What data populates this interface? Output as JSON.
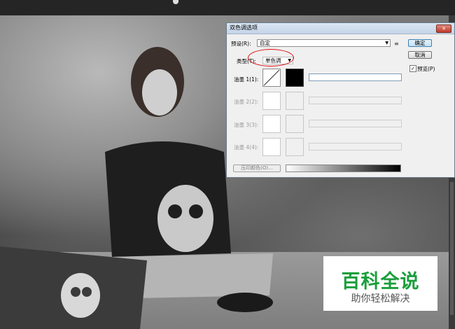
{
  "dialog": {
    "title": "双色调选项",
    "close_label": "✕",
    "preset_label": "预设(R):",
    "preset_value": "自定",
    "type_label": "类型(T):",
    "type_value": "单色调",
    "ok_label": "确定",
    "cancel_label": "取消",
    "preview_label": "预览(P)",
    "preview_checked": true,
    "inks": [
      {
        "label": "油墨 1(1):",
        "enabled": true
      },
      {
        "label": "油墨 2(2):",
        "enabled": false
      },
      {
        "label": "油墨 3(3):",
        "enabled": false
      },
      {
        "label": "油墨 4(4):",
        "enabled": false
      }
    ],
    "overprint_label": "压印颜色(O)..."
  },
  "watermark": {
    "title": "百科全说",
    "subtitle": "助你轻松解决"
  },
  "colors": {
    "accent": "#1a9e3c",
    "highlight_ellipse": "#dd1111"
  }
}
